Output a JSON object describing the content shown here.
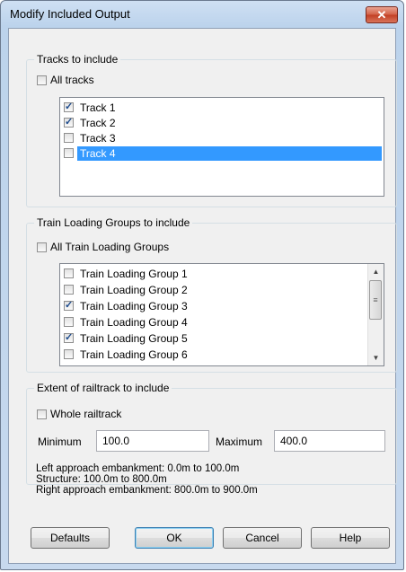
{
  "window": {
    "title": "Modify Included Output",
    "close_glyph": "✕"
  },
  "tracks": {
    "group_label": "Tracks to include",
    "all_label": "All tracks",
    "all_checked": false,
    "items": [
      {
        "label": "Track 1",
        "checked": true
      },
      {
        "label": "Track 2",
        "checked": true
      },
      {
        "label": "Track 3",
        "checked": false
      },
      {
        "label": "Track 4",
        "checked": false,
        "selected": true
      }
    ]
  },
  "loading_groups": {
    "group_label": "Train Loading Groups to include",
    "all_label": "All Train Loading Groups",
    "all_checked": false,
    "items": [
      {
        "label": "Train Loading Group 1",
        "checked": false
      },
      {
        "label": "Train Loading Group 2",
        "checked": false
      },
      {
        "label": "Train Loading Group 3",
        "checked": true
      },
      {
        "label": "Train Loading Group 4",
        "checked": false
      },
      {
        "label": "Train Loading Group 5",
        "checked": true
      },
      {
        "label": "Train Loading Group 6",
        "checked": false
      }
    ]
  },
  "extent": {
    "group_label": "Extent of railtrack to include",
    "whole_label": "Whole railtrack",
    "whole_checked": false,
    "min_label": "Minimum",
    "min_value": "100.0",
    "max_label": "Maximum",
    "max_value": "400.0",
    "info_lines": [
      "Left approach embankment: 0.0m to 100.0m",
      "Structure: 100.0m to 800.0m",
      "Right approach embankment: 800.0m to 900.0m"
    ]
  },
  "buttons": {
    "defaults": "Defaults",
    "ok": "OK",
    "cancel": "Cancel",
    "help": "Help"
  }
}
